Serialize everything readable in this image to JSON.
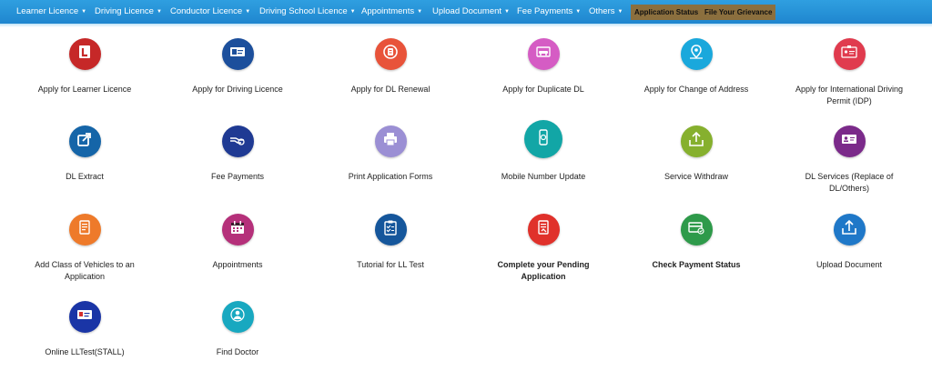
{
  "nav": {
    "items": [
      {
        "label": "Learner Licence"
      },
      {
        "label": "Driving Licence"
      },
      {
        "label": "Conductor Licence"
      },
      {
        "label": "Driving School Licence"
      },
      {
        "label": "Appointments"
      },
      {
        "label": "Upload Document"
      },
      {
        "label": "Fee Payments"
      },
      {
        "label": "Others"
      }
    ],
    "buttons": [
      {
        "label": "Application Status"
      },
      {
        "label": "File Your Grievance"
      }
    ],
    "colors": {
      "bar": "#1f86cf",
      "button": "#8b6f3e"
    }
  },
  "services": [
    {
      "line1": "Apply for Learner Licence",
      "line2": "",
      "color": "#c62828",
      "icon": "learner-l-icon"
    },
    {
      "line1": "Apply for Driving Licence",
      "line2": "",
      "color": "#1c4f9c",
      "icon": "driving-licence-card-icon"
    },
    {
      "line1": "Apply for DL Renewal",
      "line2": "",
      "color": "#e8533a",
      "icon": "renewal-icon"
    },
    {
      "line1": "Apply for Duplicate DL",
      "line2": "",
      "color": "#d55cc4",
      "icon": "duplicate-dl-icon"
    },
    {
      "line1": "Apply for Change of Address",
      "line2": "",
      "color": "#1aa8dc",
      "icon": "location-pin-icon"
    },
    {
      "line1": "Apply for International Driving",
      "line2": "Permit (IDP)",
      "color": "#e03b4e",
      "icon": "idp-card-icon"
    },
    {
      "line1": "DL Extract",
      "line2": "",
      "color": "#1565a8",
      "icon": "extract-share-icon"
    },
    {
      "line1": "Fee Payments",
      "line2": "",
      "color": "#1f3a93",
      "icon": "hand-coin-icon"
    },
    {
      "line1": "Print Application Forms",
      "line2": "",
      "color": "#9b8fd4",
      "icon": "printer-icon"
    },
    {
      "line1": "Mobile Number Update",
      "line2": "",
      "color": "#12a6a6",
      "icon": "mobile-phone-icon"
    },
    {
      "line1": "Service Withdraw",
      "line2": "",
      "color": "#86b02e",
      "icon": "withdraw-box-icon"
    },
    {
      "line1": "DL Services (Replace of",
      "line2": "DL/Others)",
      "color": "#7b2a8a",
      "icon": "id-card-icon"
    },
    {
      "line1": "Add Class of Vehicles to an",
      "line2": "Application",
      "color": "#ee7a2a",
      "icon": "document-list-icon"
    },
    {
      "line1": "Appointments",
      "line2": "",
      "color": "#b5307a",
      "icon": "calendar-icon"
    },
    {
      "line1": "Tutorial for LL Test",
      "line2": "",
      "color": "#15569b",
      "icon": "clipboard-check-icon"
    },
    {
      "line1": "Complete your Pending",
      "line2": "Application",
      "color": "#e0312b",
      "icon": "pending-form-icon",
      "bold": true
    },
    {
      "line1": "Check Payment Status",
      "line2": "",
      "color": "#2e9a4a",
      "icon": "payment-card-check-icon",
      "bold": true
    },
    {
      "line1": "Upload Document",
      "line2": "",
      "color": "#1f78c8",
      "icon": "upload-icon"
    },
    {
      "line1": "Online LLTest(STALL)",
      "line2": "",
      "color": "#1a35a6",
      "icon": "ll-stall-card-icon"
    },
    {
      "line1": "Find Doctor",
      "line2": "",
      "color": "#18a8c0",
      "icon": "doctor-icon"
    }
  ]
}
